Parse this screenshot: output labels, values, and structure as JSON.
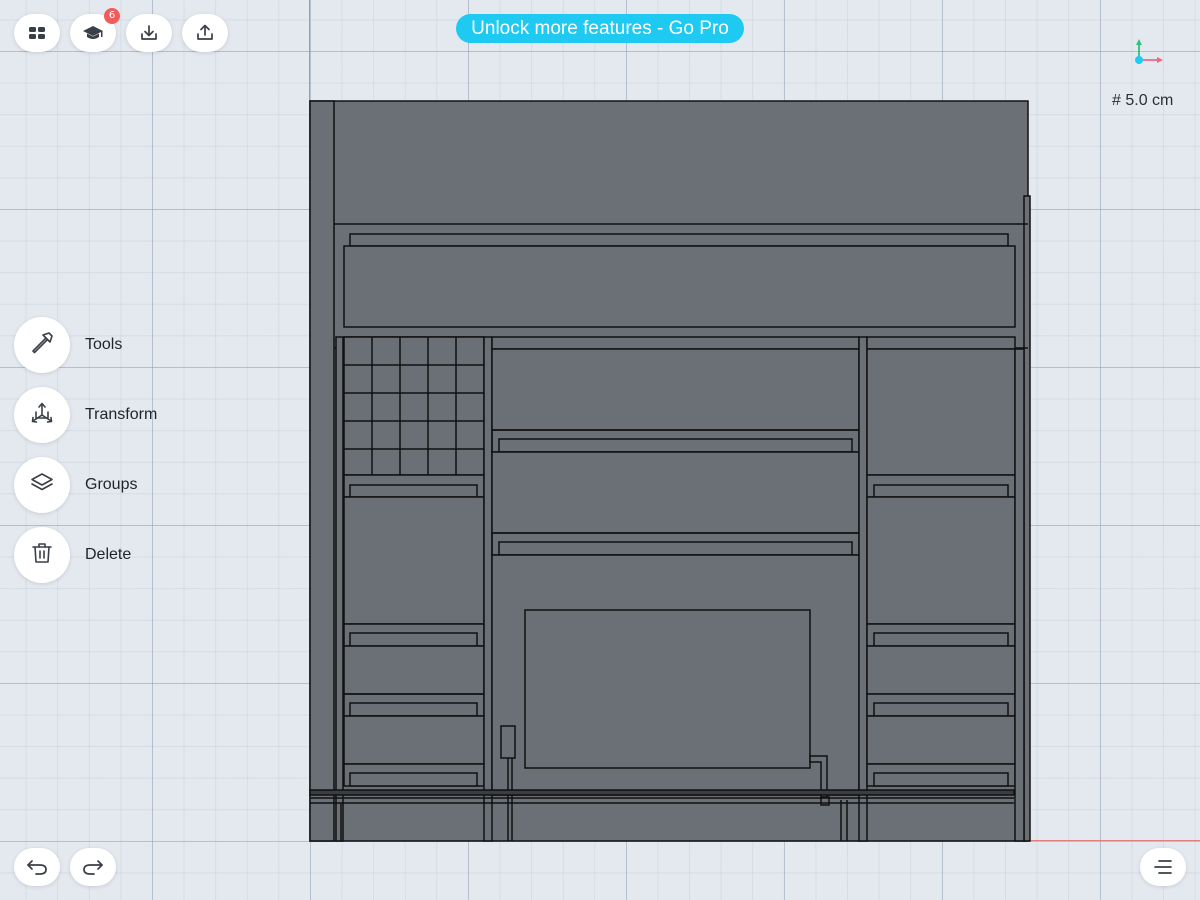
{
  "toolbar": {
    "menu_icon": "grid-menu-icon",
    "learn_icon": "graduation-cap-icon",
    "learn_badge": "6",
    "import_icon": "import-icon",
    "export_icon": "share-export-icon"
  },
  "promo": {
    "label": "Unlock more features - Go Pro",
    "color": "#1ec9f2"
  },
  "viewport": {
    "grid_size_label": "# 5.0 cm",
    "gizmo_icon": "axis-gizmo-icon",
    "model_color": "#6b6f76",
    "outline_color": "#111111"
  },
  "side_menu": {
    "items": [
      {
        "label": "Tools",
        "icon": "hammer-icon"
      },
      {
        "label": "Transform",
        "icon": "transform-icon"
      },
      {
        "label": "Groups",
        "icon": "layers-icon"
      },
      {
        "label": "Delete",
        "icon": "trash-icon"
      }
    ]
  },
  "bottom": {
    "undo_icon": "undo-icon",
    "redo_icon": "redo-icon",
    "options_icon": "options-menu-icon"
  }
}
